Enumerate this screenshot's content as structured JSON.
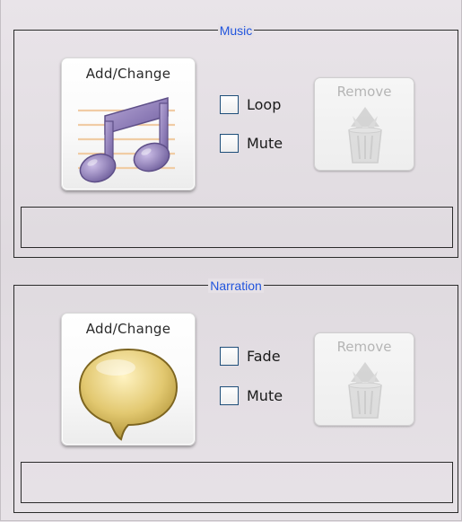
{
  "music": {
    "legend": "Music",
    "add_label": "Add/Change",
    "option1": "Loop",
    "option2": "Mute",
    "remove_label": "Remove",
    "status_text": ""
  },
  "narration": {
    "legend": "Narration",
    "add_label": "Add/Change",
    "option1": "Fade",
    "option2": "Mute",
    "remove_label": "Remove",
    "status_text": ""
  },
  "colors": {
    "legend": "#2255dd",
    "border": "#2b2b2b",
    "background": "#e6e1e6",
    "disabled_text": "#b5b5b5"
  },
  "icons": {
    "music_add": "music-note-icon",
    "narration_add": "speech-bubble-icon",
    "remove": "trash-can-icon"
  }
}
